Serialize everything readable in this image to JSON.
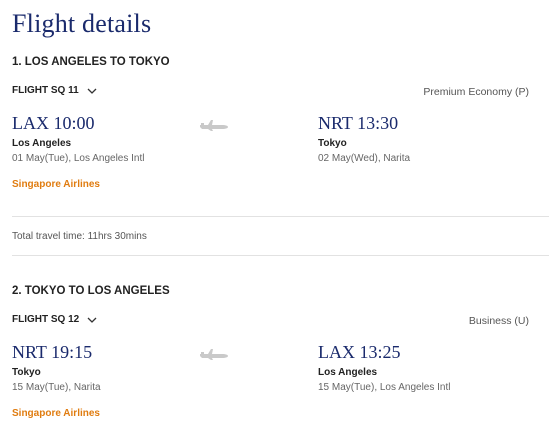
{
  "page": {
    "title": "Flight details"
  },
  "segments": [
    {
      "heading": "1. LOS ANGELES TO TOKYO",
      "flight_number": "FLIGHT SQ 11",
      "cabin": "Premium Economy (P)",
      "departure": {
        "code_time": "LAX 10:00",
        "city": "Los Angeles",
        "detail": "01 May(Tue), Los Angeles Intl"
      },
      "arrival": {
        "code_time": "NRT 13:30",
        "city": "Tokyo",
        "detail": "02 May(Wed), Narita"
      },
      "airline": "Singapore Airlines",
      "total_travel_time": "Total travel time: 11hrs 30mins"
    },
    {
      "heading": "2. TOKYO TO LOS ANGELES",
      "flight_number": "FLIGHT SQ 12",
      "cabin": "Business (U)",
      "departure": {
        "code_time": "NRT 19:15",
        "city": "Tokyo",
        "detail": "15 May(Tue), Narita"
      },
      "arrival": {
        "code_time": "LAX 13:25",
        "city": "Los Angeles",
        "detail": "15 May(Tue), Los Angeles Intl"
      },
      "airline": "Singapore Airlines"
    }
  ],
  "colors": {
    "title": "#1a2a6c",
    "airline": "#e07c10",
    "divider": "#e2e2e2"
  },
  "icons": {
    "expand": "chevron-down-icon",
    "flight": "airplane-icon"
  }
}
